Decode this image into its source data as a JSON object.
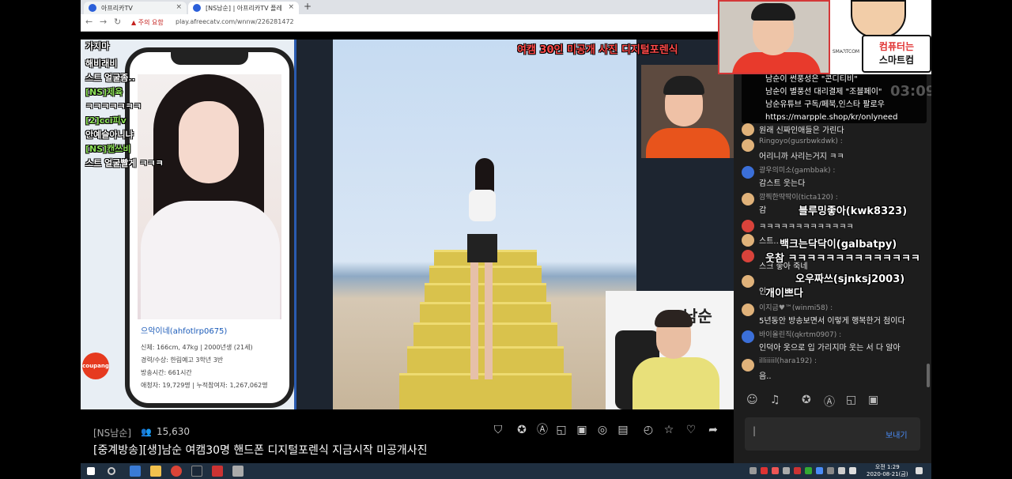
{
  "browser": {
    "tabs": [
      {
        "label": "아프리카TV"
      },
      {
        "label": "[NS남순] | 아프리카TV 플레"
      }
    ],
    "warning": "주의 요함",
    "url": "play.afreecatv.com/wnnw/226281472"
  },
  "video": {
    "caption_banner": "여캠 30인 미공개 사진 디지털포렌식",
    "overlay_chat": [
      {
        "text": "가지마",
        "name": false
      },
      {
        "text": "해비래비",
        "name": false
      },
      {
        "text": "스트 얼굴좀..",
        "name": false
      },
      {
        "text": "[NS]제육",
        "name": true
      },
      {
        "text": "ㅋㅋㅋㅋㅋㅋㅋ",
        "name": false
      },
      {
        "text": "[2]cci피v",
        "name": true
      },
      {
        "text": "안예슬아니냐",
        "name": false
      },
      {
        "text": "[NS]캔쓰비",
        "name": true
      },
      {
        "text": "스트 얼굴빨게 ㅋㅋㅋ",
        "name": false
      }
    ],
    "phone_profile": {
      "name": "으악이네(ahfotlrp0675)",
      "info": [
        "신체: 166cm, 47kg  |  2000년생 (21세)",
        "경력/수상: 한림예고 3학년 3반",
        "방송시간: 661시간",
        "애청자: 19,729명  |  누적참여자: 1,267,062명"
      ]
    },
    "coupang": "coupang",
    "cam_logo": "남순"
  },
  "stream": {
    "bj": "[NS남순]",
    "viewers": "15,630",
    "title": "[중계방송][생]남순 여캠30명 핸드폰 디지털포렌식 지금시작 미공개사진"
  },
  "chat": {
    "notice": [
      "남순이 썬풍성은 \"콘디티비\"",
      "남순이 별풍선 대리결제 \"조블페이\"",
      "남순유튜브 구독/페북,인스타 팔로우",
      "https://marpple.shop/kr/onlyneed"
    ],
    "timer": "03:09",
    "messages": [
      {
        "user": "",
        "text": "원래 신짜인애들은 가린다",
        "avatar": "plain"
      },
      {
        "user": "Ringoyo(gusrbwkdwk) :",
        "text": "어리니까 사리는거지 ㅋㅋ",
        "avatar": "plain"
      },
      {
        "user": "광우의미소(gambbak) :",
        "text": "감스트 웃는다",
        "avatar": "blue"
      },
      {
        "user": "깜찍한딱딱이(ticta120) :",
        "text": "감",
        "avatar": "plain"
      },
      {
        "user": "",
        "text": "ㅋㅋㅋㅋㅋㅋㅋㅋㅋㅋㅋㅋㅋ",
        "avatar": "red"
      },
      {
        "user": "",
        "text": "스트...",
        "avatar": "plain"
      },
      {
        "user": "",
        "text": "스크 좋아 죽네",
        "avatar": "red"
      },
      {
        "user": "",
        "text": "인",
        "avatar": "plain"
      },
      {
        "user": "이지금♥™(winmi58) :",
        "text": "5년동안 방송보면서 이렇게 행복한거 첨이다",
        "avatar": "plain"
      },
      {
        "user": "바이올린직(qkrtm0907) :",
        "text": "인덕아 옷으로 입 가리지마 웃는 서 다 알아",
        "avatar": "blue"
      },
      {
        "user": "illiiiiil(hara192) :",
        "text": "음..",
        "avatar": "plain"
      }
    ],
    "overlay_lines": [
      "블루밍좋아(kwk8323)",
      "백크는닥닥이(galbatpy)",
      "웃참 ㅋㅋㅋㅋㅋㅋㅋㅋㅋㅋㅋㅋㅋㅋ",
      "오우짜쓰(sjnksj2003)",
      "개이쁘다"
    ],
    "send_label": "보내기"
  },
  "sponsor": {
    "line1": "컴퓨터는",
    "line2": "스마트컴",
    "logo": "SMARTCOM"
  },
  "taskbar": {
    "time": "오전 1:29",
    "date": "2020-08-21(금)"
  }
}
